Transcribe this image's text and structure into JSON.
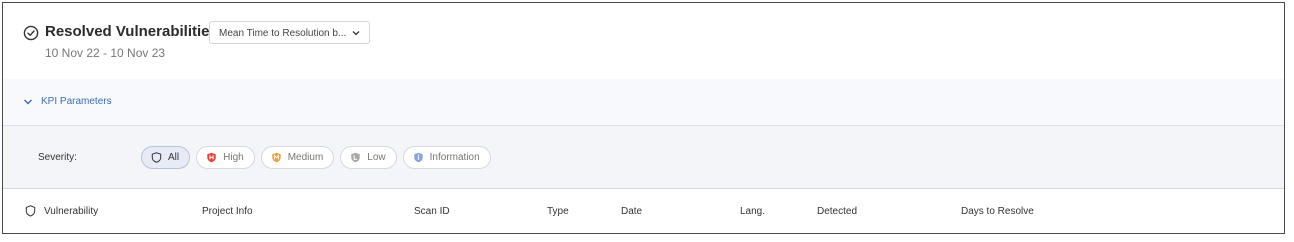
{
  "header": {
    "title": "Resolved Vulnerabilities",
    "dropdown_label": "Mean Time to Resolution b...",
    "date_range": "10 Nov 22 - 10 Nov 23"
  },
  "kpi": {
    "label": "KPI Parameters"
  },
  "severity": {
    "label": "Severity:",
    "chips": [
      {
        "label": "All",
        "icon": "shield-outline-icon",
        "active": true
      },
      {
        "label": "High",
        "icon": "shield-high-icon",
        "color": "#e2453c"
      },
      {
        "label": "Medium",
        "icon": "shield-medium-icon",
        "color": "#eaa23a"
      },
      {
        "label": "Low",
        "icon": "shield-low-icon",
        "color": "#a8a8a8"
      },
      {
        "label": "Information",
        "icon": "shield-info-icon",
        "color": "#8ba3dc"
      }
    ]
  },
  "table": {
    "columns": [
      "Vulnerability",
      "Project Info",
      "Scan ID",
      "Type",
      "Date",
      "Lang.",
      "Detected",
      "Days to Resolve"
    ]
  },
  "colors": {
    "accent": "#3f6cb5",
    "high": "#e2453c",
    "medium": "#eaa23a",
    "low": "#a8a8a8",
    "info": "#8ba3dc"
  }
}
